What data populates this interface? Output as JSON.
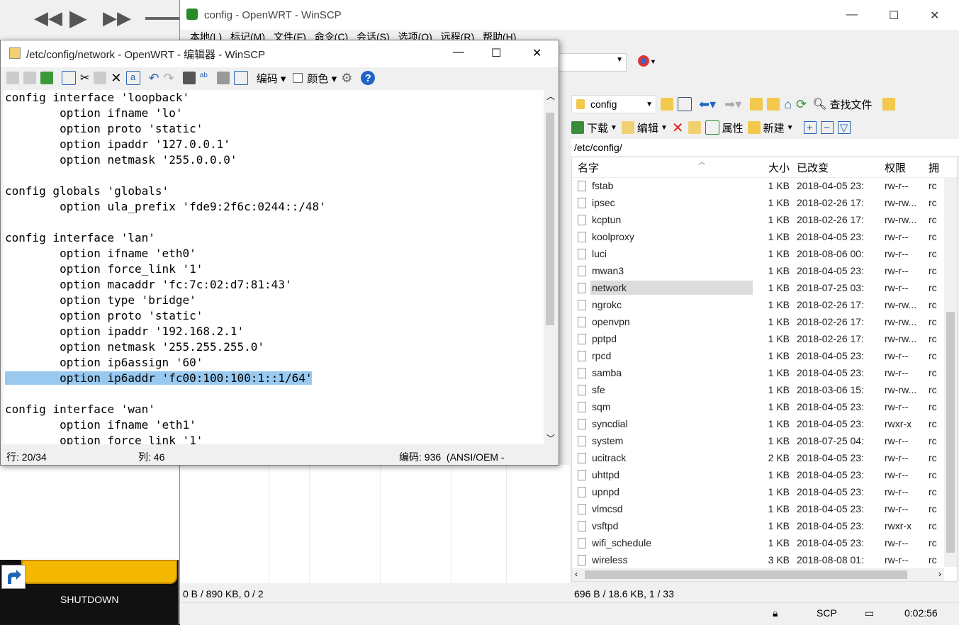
{
  "main_window": {
    "title": "config - OpenWRT - WinSCP",
    "menu": [
      "本地(L)",
      "标记(M)",
      "文件(F)",
      "命令(C)",
      "会话(S)",
      "选项(O)",
      "远程(R)",
      "帮助(H)"
    ]
  },
  "editor": {
    "title": "/etc/config/network - OpenWRT - 编辑器 - WinSCP",
    "toolbar": {
      "encoding_label": "编码",
      "color_label": "颜色"
    },
    "lines": [
      "config interface 'loopback'",
      "        option ifname 'lo'",
      "        option proto 'static'",
      "        option ipaddr '127.0.0.1'",
      "        option netmask '255.0.0.0'",
      "",
      "config globals 'globals'",
      "        option ula_prefix 'fde9:2f6c:0244::/48'",
      "",
      "config interface 'lan'",
      "        option ifname 'eth0'",
      "        option force_link '1'",
      "        option macaddr 'fc:7c:02:d7:81:43'",
      "        option type 'bridge'",
      "        option proto 'static'",
      "        option ipaddr '192.168.2.1'",
      "        option netmask '255.255.255.0'",
      "        option ip6assign '60'",
      "        option ip6addr 'fc00:100:100:1::1/64'",
      "",
      "config interface 'wan'",
      "        option ifname 'eth1'",
      "        option force_link '1'"
    ],
    "highlighted_line": 18,
    "status": {
      "line": "行: 20/34",
      "col": "列: 46",
      "encoding": "编码: 936  (ANSI/OEM -"
    }
  },
  "remote": {
    "dir_combo": "config",
    "find_label": "查找文件",
    "toolbar2": {
      "download": "下载",
      "edit": "编辑",
      "properties": "属性",
      "new": "新建"
    },
    "path": "/etc/config/",
    "columns": {
      "name": "名字",
      "size": "大小",
      "changed": "已改变",
      "rights": "权限",
      "owner": "拥"
    },
    "files": [
      {
        "name": "fstab",
        "size": "1 KB",
        "changed": "2018-04-05 23:",
        "rights": "rw-r--",
        "owner": "rc"
      },
      {
        "name": "ipsec",
        "size": "1 KB",
        "changed": "2018-02-26 17:",
        "rights": "rw-rw...",
        "owner": "rc"
      },
      {
        "name": "kcptun",
        "size": "1 KB",
        "changed": "2018-02-26 17:",
        "rights": "rw-rw...",
        "owner": "rc"
      },
      {
        "name": "koolproxy",
        "size": "1 KB",
        "changed": "2018-04-05 23:",
        "rights": "rw-r--",
        "owner": "rc"
      },
      {
        "name": "luci",
        "size": "1 KB",
        "changed": "2018-08-06 00:",
        "rights": "rw-r--",
        "owner": "rc"
      },
      {
        "name": "mwan3",
        "size": "1 KB",
        "changed": "2018-04-05 23:",
        "rights": "rw-r--",
        "owner": "rc"
      },
      {
        "name": "network",
        "size": "1 KB",
        "changed": "2018-07-25 03:",
        "rights": "rw-r--",
        "owner": "rc"
      },
      {
        "name": "ngrokc",
        "size": "1 KB",
        "changed": "2018-02-26 17:",
        "rights": "rw-rw...",
        "owner": "rc"
      },
      {
        "name": "openvpn",
        "size": "1 KB",
        "changed": "2018-02-26 17:",
        "rights": "rw-rw...",
        "owner": "rc"
      },
      {
        "name": "pptpd",
        "size": "1 KB",
        "changed": "2018-02-26 17:",
        "rights": "rw-rw...",
        "owner": "rc"
      },
      {
        "name": "rpcd",
        "size": "1 KB",
        "changed": "2018-04-05 23:",
        "rights": "rw-r--",
        "owner": "rc"
      },
      {
        "name": "samba",
        "size": "1 KB",
        "changed": "2018-04-05 23:",
        "rights": "rw-r--",
        "owner": "rc"
      },
      {
        "name": "sfe",
        "size": "1 KB",
        "changed": "2018-03-06 15:",
        "rights": "rw-rw...",
        "owner": "rc"
      },
      {
        "name": "sqm",
        "size": "1 KB",
        "changed": "2018-04-05 23:",
        "rights": "rw-r--",
        "owner": "rc"
      },
      {
        "name": "syncdial",
        "size": "1 KB",
        "changed": "2018-04-05 23:",
        "rights": "rwxr-x",
        "owner": "rc"
      },
      {
        "name": "system",
        "size": "1 KB",
        "changed": "2018-07-25 04:",
        "rights": "rw-r--",
        "owner": "rc"
      },
      {
        "name": "ucitrack",
        "size": "2 KB",
        "changed": "2018-04-05 23:",
        "rights": "rw-r--",
        "owner": "rc"
      },
      {
        "name": "uhttpd",
        "size": "1 KB",
        "changed": "2018-04-05 23:",
        "rights": "rw-r--",
        "owner": "rc"
      },
      {
        "name": "upnpd",
        "size": "1 KB",
        "changed": "2018-04-05 23:",
        "rights": "rw-r--",
        "owner": "rc"
      },
      {
        "name": "vlmcsd",
        "size": "1 KB",
        "changed": "2018-04-05 23:",
        "rights": "rw-r--",
        "owner": "rc"
      },
      {
        "name": "vsftpd",
        "size": "1 KB",
        "changed": "2018-04-05 23:",
        "rights": "rwxr-x",
        "owner": "rc"
      },
      {
        "name": "wifi_schedule",
        "size": "1 KB",
        "changed": "2018-04-05 23:",
        "rights": "rw-r--",
        "owner": "rc"
      },
      {
        "name": "wireless",
        "size": "3 KB",
        "changed": "2018-08-08 01:",
        "rights": "rw-r--",
        "owner": "rc"
      }
    ],
    "selected_file": "network"
  },
  "status": {
    "local": "0 B / 890 KB,   0 / 2",
    "remote": "696 B / 18.6 KB,   1 / 33",
    "protocol": "SCP",
    "time": "0:02:56"
  },
  "background": {
    "shutdown_label": "SHUTDOWN"
  },
  "colors": {
    "selection": "#99c9ef",
    "accent": "#0078d7"
  }
}
